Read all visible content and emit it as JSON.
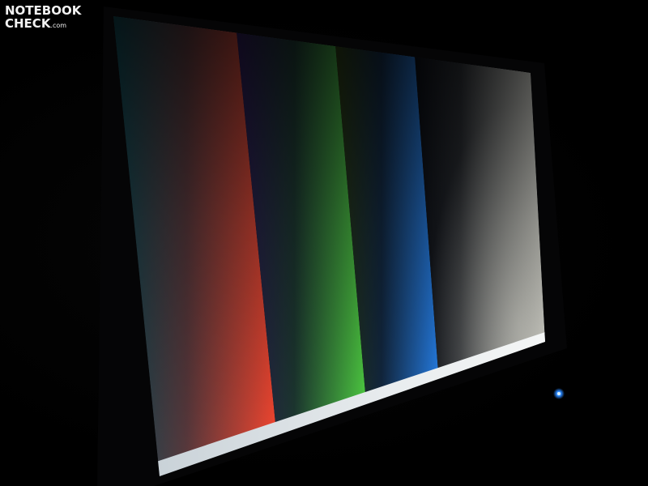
{
  "watermark": {
    "line1": "NOTEBOOK",
    "line2": "CHECK",
    "suffix": ".com"
  },
  "bars": [
    {
      "name": "red",
      "color": "#ff3a22"
    },
    {
      "name": "green",
      "color": "#44d040"
    },
    {
      "name": "blue",
      "color": "#1f7fff"
    },
    {
      "name": "gray",
      "color": "#d9d9d0"
    }
  ]
}
